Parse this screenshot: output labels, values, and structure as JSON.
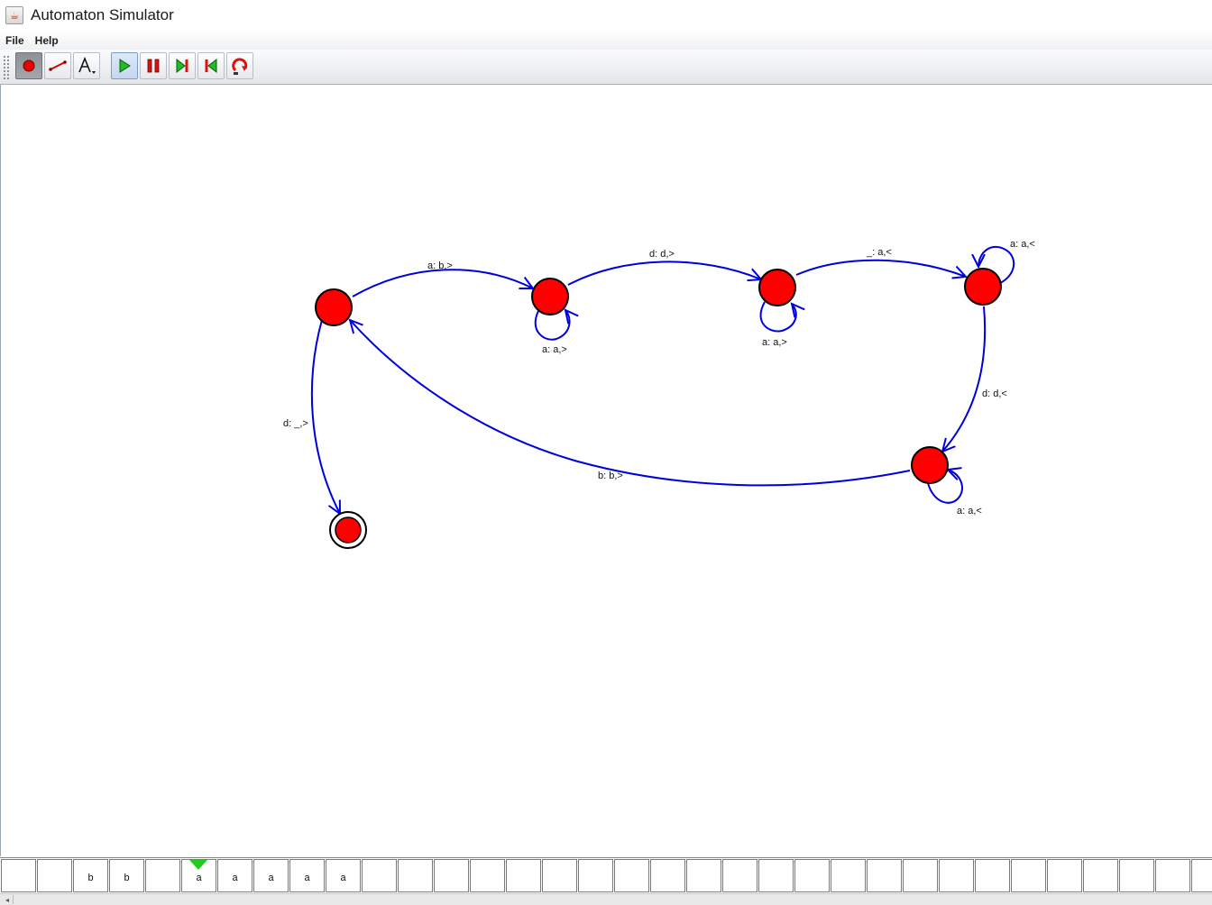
{
  "window": {
    "title": "Automaton Simulator"
  },
  "menu": {
    "items": [
      "File",
      "Help"
    ]
  },
  "toolbar": {
    "buttons": [
      {
        "name": "add-state",
        "icon": "red-circle-icon",
        "pressed": true
      },
      {
        "name": "add-transition",
        "icon": "red-line-icon"
      },
      {
        "name": "text-tool",
        "icon": "letter-a-dropdown-icon"
      },
      {
        "name": "run",
        "icon": "green-play-icon",
        "pressed": true
      },
      {
        "name": "pause",
        "icon": "red-pause-icon"
      },
      {
        "name": "step-forward",
        "icon": "step-forward-icon"
      },
      {
        "name": "step-back",
        "icon": "step-back-icon"
      },
      {
        "name": "reset",
        "icon": "reset-icon"
      }
    ]
  },
  "automaton": {
    "colors": {
      "state": "#ff0000",
      "transition": "#0000dd"
    },
    "transition_labels": {
      "q0_q1": "a: b,>",
      "q1_q2": "d: d,>",
      "q2_q3": "_: a,<",
      "q3_q4": "d: d,<",
      "q4_q0": "b: b,>",
      "q0_qf": "d: _,>",
      "q1_loop": "a: a,>",
      "q2_loop": "a: a,>",
      "q3_loop": "a: a,<",
      "q4_loop": "a: a,<"
    }
  },
  "tape": {
    "cells": [
      "",
      "",
      "b",
      "b",
      "",
      "a",
      "a",
      "a",
      "a",
      "a",
      "",
      "",
      "",
      "",
      "",
      "",
      "",
      "",
      "",
      "",
      "",
      "",
      "",
      "",
      "",
      "",
      "",
      "",
      "",
      "",
      "",
      "",
      "",
      ""
    ],
    "head_index": 5,
    "head_color": "#22cc22"
  },
  "scrollbar": {
    "left_arrow": "◂"
  }
}
